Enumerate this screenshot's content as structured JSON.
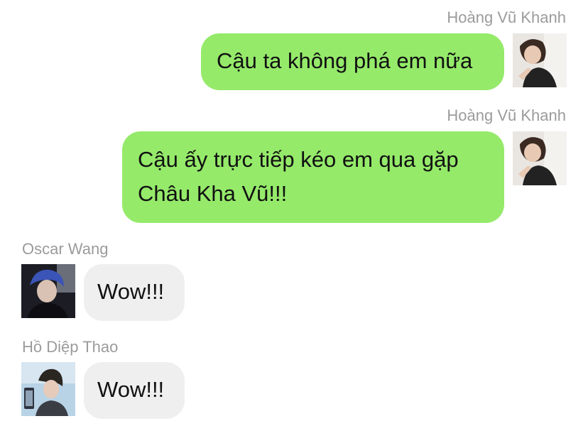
{
  "messages": [
    {
      "sender": "Hoàng Vũ Khanh",
      "text": "Cậu ta không phá em nữa",
      "direction": "outgoing",
      "avatar": "avatar-hoang-vu-khanh"
    },
    {
      "sender": "Hoàng Vũ Khanh",
      "text": "Cậu ấy trực tiếp kéo em qua gặp Châu Kha Vũ!!!",
      "direction": "outgoing",
      "avatar": "avatar-hoang-vu-khanh"
    },
    {
      "sender": "Oscar Wang",
      "text": "Wow!!!",
      "direction": "incoming",
      "avatar": "avatar-oscar-wang"
    },
    {
      "sender": "Hồ Diệp Thao",
      "text": "Wow!!!",
      "direction": "incoming",
      "avatar": "avatar-ho-diep-thao"
    }
  ],
  "colors": {
    "outgoing_bubble": "#95ea6a",
    "incoming_bubble": "#efefef",
    "sender_name": "#9b9b9b"
  }
}
